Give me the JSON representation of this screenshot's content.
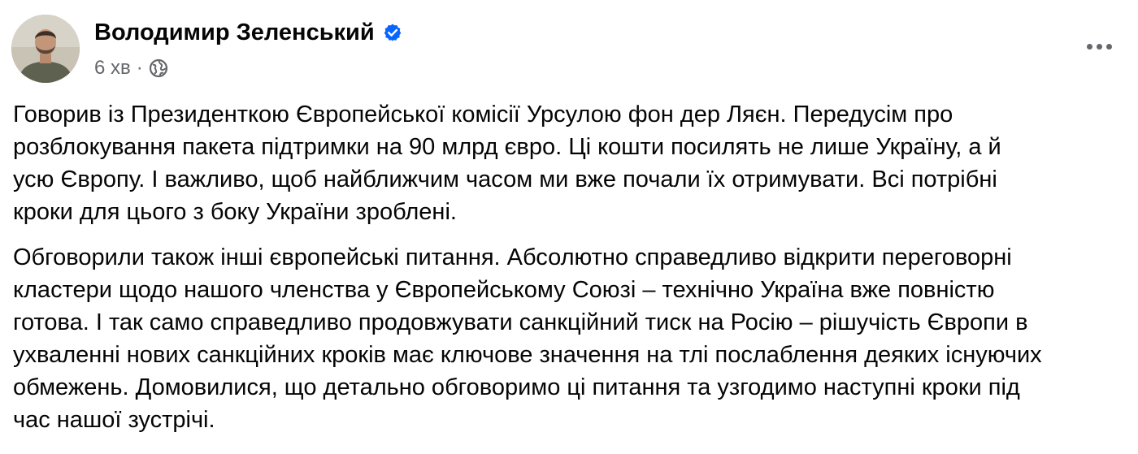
{
  "post": {
    "author_name": "Володимир Зеленський",
    "verified": true,
    "timestamp": "6 хв",
    "separator": "·",
    "audience_icon": "globe-icon",
    "more_icon": "more-options-icon",
    "avatar_icon": "profile-photo",
    "paragraphs": [
      "Говорив із Президенткою Європейської комісії Урсулою фон дер Ляєн. Передусім про\nрозблокування пакета підтримки на 90 млрд євро. Ці кошти посилять не лише Україну, а й\nусю Європу. І важливо, щоб найближчим часом ми вже почали їх отримувати. Всі потрібні\nкроки для цього з боку України зроблені.",
      "Обговорили також інші європейські питання. Абсолютно справедливо відкрити переговорні\nкластери щодо нашого членства у Європейському Союзі – технічно Україна вже повністю\nготова. І так само справедливо продовжувати санкційний тиск на Росію – рішучість Європи в\nухваленні нових санкційних кроків має ключове значення на тлі послаблення деяких існуючих\nобмежень. Домовилися, що детально обговоримо ці питання та узгодимо наступні кроки під\nчас нашої зустрічі."
    ]
  },
  "colors": {
    "text": "#050505",
    "secondary": "#65676b",
    "verified_badge": "#0866ff"
  }
}
